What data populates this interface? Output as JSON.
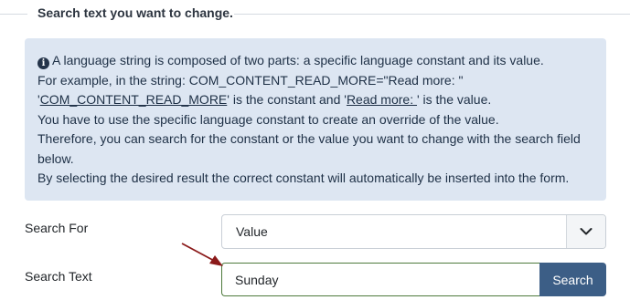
{
  "fieldset": {
    "legend": "Search text you want to change."
  },
  "info_alert": {
    "icon": "info-circle-icon",
    "line1": "A language string is composed of two parts: a specific language constant and its value.",
    "line2": "For example, in the string: COM_CONTENT_READ_MORE=\"Read more: \"",
    "line3_prefix": "'",
    "line3_constant": "COM_CONTENT_READ_MORE",
    "line3_middle": "' is the constant and '",
    "line3_value": "Read more: ",
    "line3_suffix": "' is the value.",
    "line4": "You have to use the specific language constant to create an override of the value.",
    "line5": "Therefore, you can search for the constant or the value you want to change with the search field",
    "line6": "below.",
    "line7": "By selecting the desired result the correct constant will automatically be inserted into the form."
  },
  "search_for": {
    "label": "Search For",
    "selected": "Value",
    "dropdown_icon": "chevron-down-icon"
  },
  "search_text": {
    "label": "Search Text",
    "value": "Sunday",
    "button_label": "Search"
  },
  "annotation": {
    "arrow_color": "#8b1a1a"
  },
  "colors": {
    "alert_bg": "#dde6f2",
    "button_bg": "#3c5e86",
    "input_border": "#4e7a3c"
  }
}
